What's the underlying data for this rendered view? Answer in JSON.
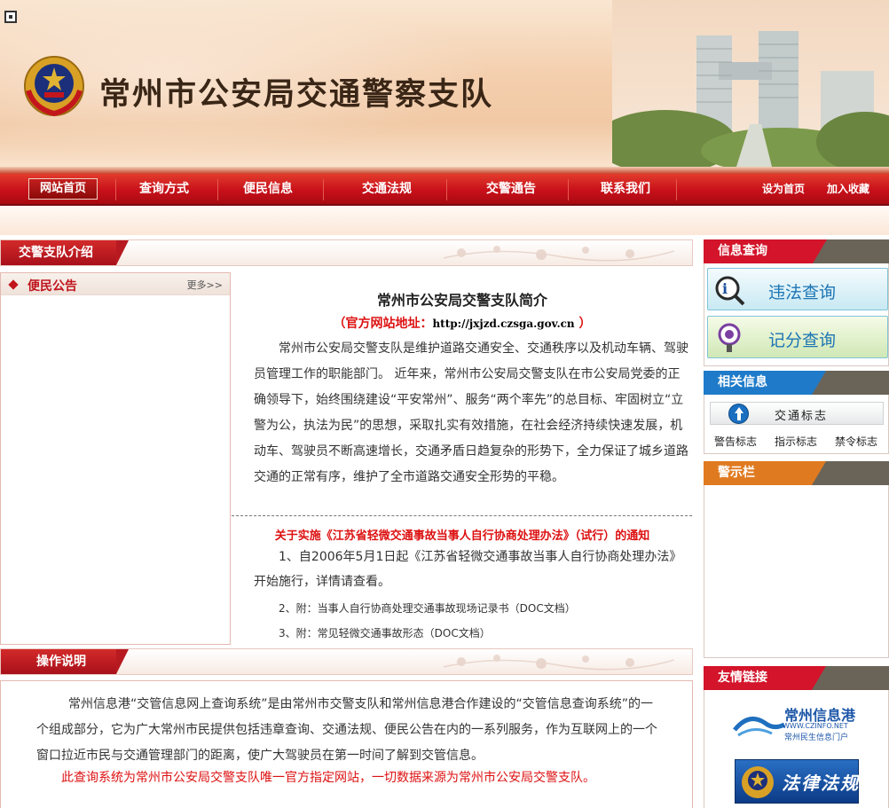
{
  "header": {
    "site_title": "常州市公安局交通警察支队"
  },
  "nav": {
    "items": [
      "网站首页",
      "查询方式",
      "便民信息",
      "交通法规",
      "交警通告",
      "联系我们"
    ],
    "right_links": [
      "设为首页",
      "加入收藏"
    ]
  },
  "intro_section": {
    "tab_label": "交警支队介绍"
  },
  "notice_panel": {
    "title": "便民公告",
    "more": "更多>>"
  },
  "intro": {
    "title": "常州市公安局交警支队简介",
    "url_prefix": "（官方网站地址：",
    "url": "http://jxjzd.czsga.gov.cn",
    "url_suffix": " ）",
    "body": "常州市公安局交警支队是维护道路交通安全、交通秩序以及机动车辆、驾驶员管理工作的职能部门。  近年来，常州市公安局交警支队在市公安局党委的正确领导下，始终围绕建设“平安常州”、服务“两个率先”的总目标、牢固树立“立警为公，执法为民”的思想，采取扎实有效措施，在社会经济持续快速发展，机动车、驾驶员不断高速增长，交通矛盾日趋复杂的形势下，全力保证了城乡道路交通的正常有序，维护了全市道路交通安全形势的平稳。"
  },
  "notice": {
    "title": "关于实施《江苏省轻微交通事故当事人自行协商处理办法》（试行）的通知",
    "p1": "1、自2006年5月1日起《江苏省轻微交通事故当事人自行协商处理办法》开始施行，详情请查看。",
    "attachment1": "2、附：当事人自行协商处理交通事故现场记录书（DOC文档）",
    "attachment2": "3、附：常见轻微交通事故形态（DOC文档）"
  },
  "operation": {
    "tab_label": "操作说明",
    "paragraph": "常州信息港“交管信息网上查询系统”是由常州市交警支队和常州信息港合作建设的“交管信息查询系统”的一个组成部分，它为广大常州市民提供包括违章查询、交通法规、便民公告在内的一系列服务，作为互联网上的一个窗口拉近市民与交通管理部门的距离，使广大驾驶员在第一时间了解到交管信息。",
    "note": "此查询系统为常州市公安局交警支队唯一官方指定网站，一切数据来源为常州市公安局交警支队。"
  },
  "sidebar": {
    "info_query_title": "信息查询",
    "violation_query": "违法查询",
    "points_query": "记分查询",
    "related_title": "相关信息",
    "traffic_signs": "交通标志",
    "sign_links": [
      "警告标志",
      "指示标志",
      "禁令标志"
    ],
    "alert_title": "警示栏",
    "friends_title": "友情链接",
    "friend1_name": "常州信息港",
    "friend1_url": "WWW.CZINFO.NET",
    "friend1_sub": "常州民生信息门户",
    "friend2_name": "法律法规"
  },
  "colors": {
    "nav_red": "#c8101a",
    "accent_red": "#d11111",
    "blue_tab": "#1f7bc9",
    "orange_tab": "#e07a20"
  }
}
